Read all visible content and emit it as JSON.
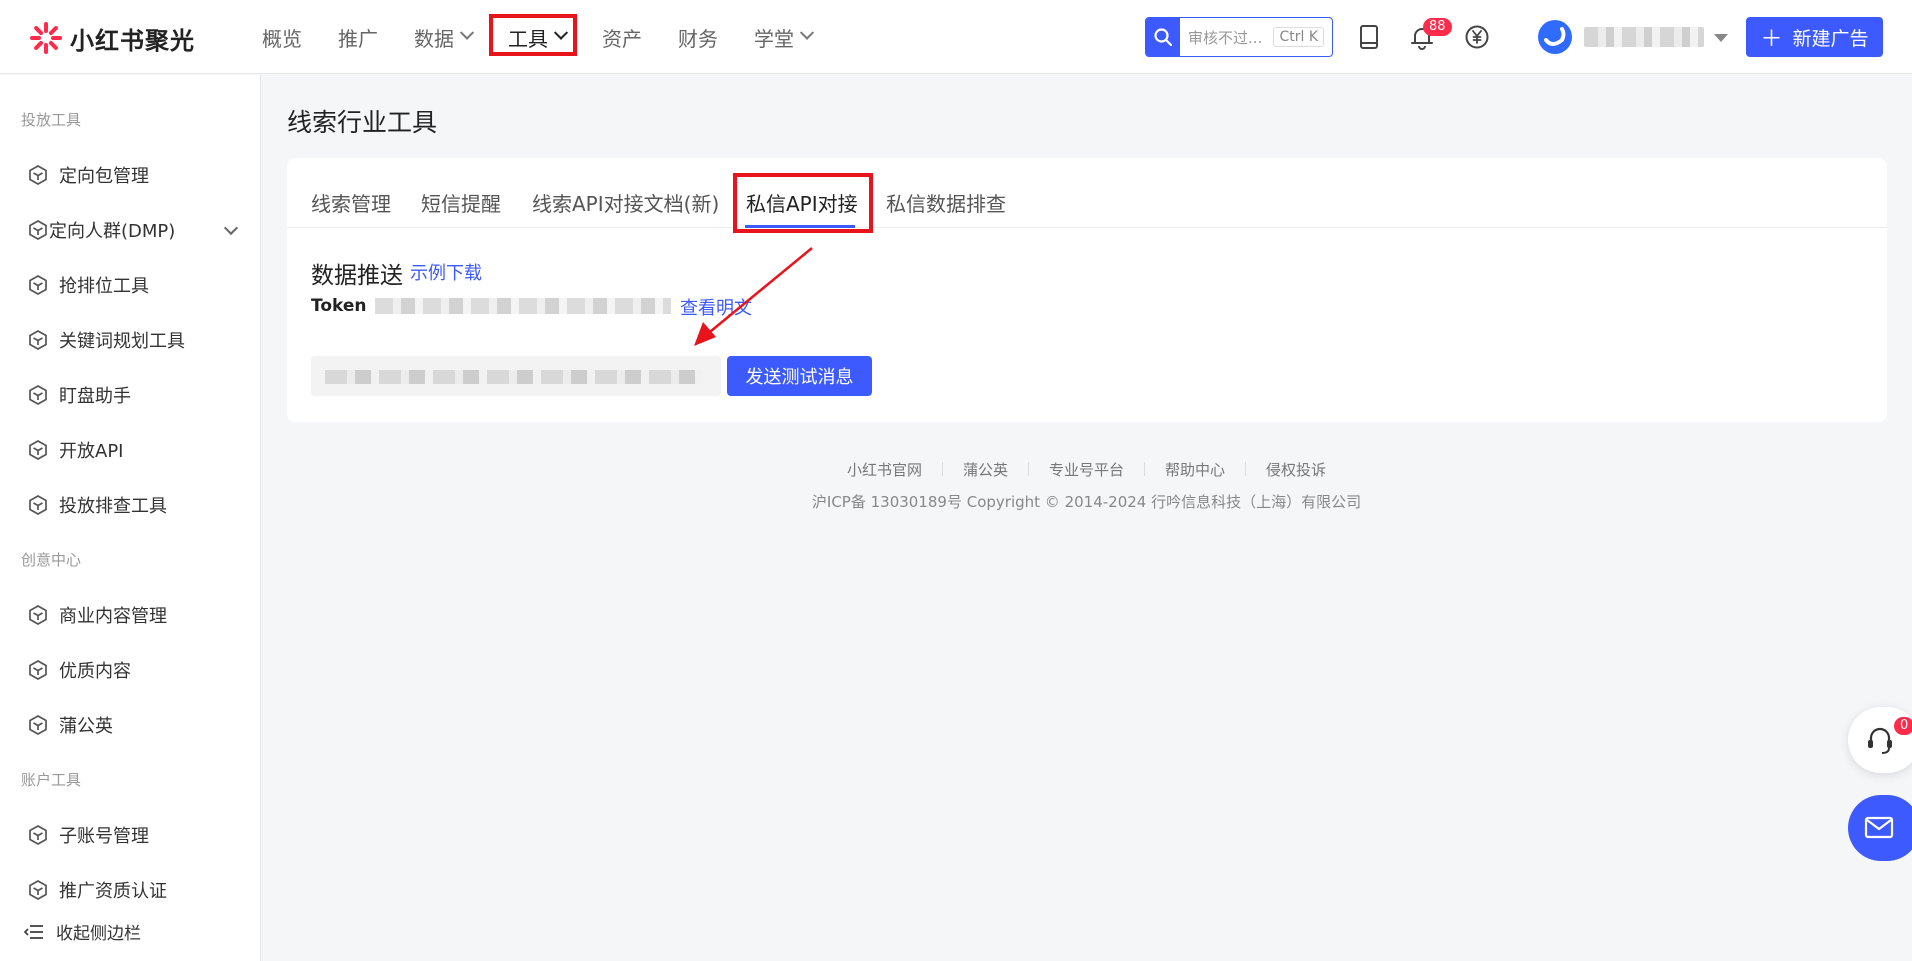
{
  "brand": {
    "name": "小红书聚光"
  },
  "nav": {
    "items": [
      {
        "label": "概览"
      },
      {
        "label": "推广"
      },
      {
        "label": "数据"
      },
      {
        "label": "工具"
      },
      {
        "label": "资产"
      },
      {
        "label": "财务"
      },
      {
        "label": "学堂"
      }
    ],
    "active": "工具"
  },
  "search": {
    "placeholder": "审核不过...",
    "shortcut": "Ctrl K"
  },
  "notifications": {
    "count": "88"
  },
  "actions": {
    "new_ad": "新建广告"
  },
  "sidebar": {
    "sections": [
      {
        "title": "投放工具",
        "items": [
          "定向包管理",
          "定向人群(DMP)",
          "抢排位工具",
          "关键词规划工具",
          "盯盘助手",
          "开放API",
          "投放排查工具"
        ]
      },
      {
        "title": "创意中心",
        "items": [
          "商业内容管理",
          "优质内容",
          "蒲公英"
        ]
      },
      {
        "title": "账户工具",
        "items": [
          "子账号管理",
          "推广资质认证"
        ]
      }
    ],
    "collapse_label": "收起侧边栏"
  },
  "main": {
    "page_title": "线索行业工具",
    "tabs": [
      {
        "label": "线索管理"
      },
      {
        "label": "短信提醒"
      },
      {
        "label": "线索API对接文档(新)"
      },
      {
        "label": "私信API对接"
      },
      {
        "label": "私信数据排查"
      }
    ],
    "active_tab": "私信API对接",
    "section_title": "数据推送",
    "sample_download": "示例下载",
    "token_label": "Token",
    "view_plain": "查看明文",
    "send_test": "发送测试消息"
  },
  "footer": {
    "links": [
      "小红书官网",
      "蒲公英",
      "专业号平台",
      "帮助中心",
      "侵权投诉"
    ],
    "copyright": "沪ICP备 13030189号 Copyright © 2014-2024 行吟信息科技（上海）有限公司"
  },
  "float": {
    "support_badge": "0"
  },
  "colors": {
    "primary": "#3d5afe",
    "highlight": "#e8141b",
    "badge": "#ff2b4a"
  }
}
